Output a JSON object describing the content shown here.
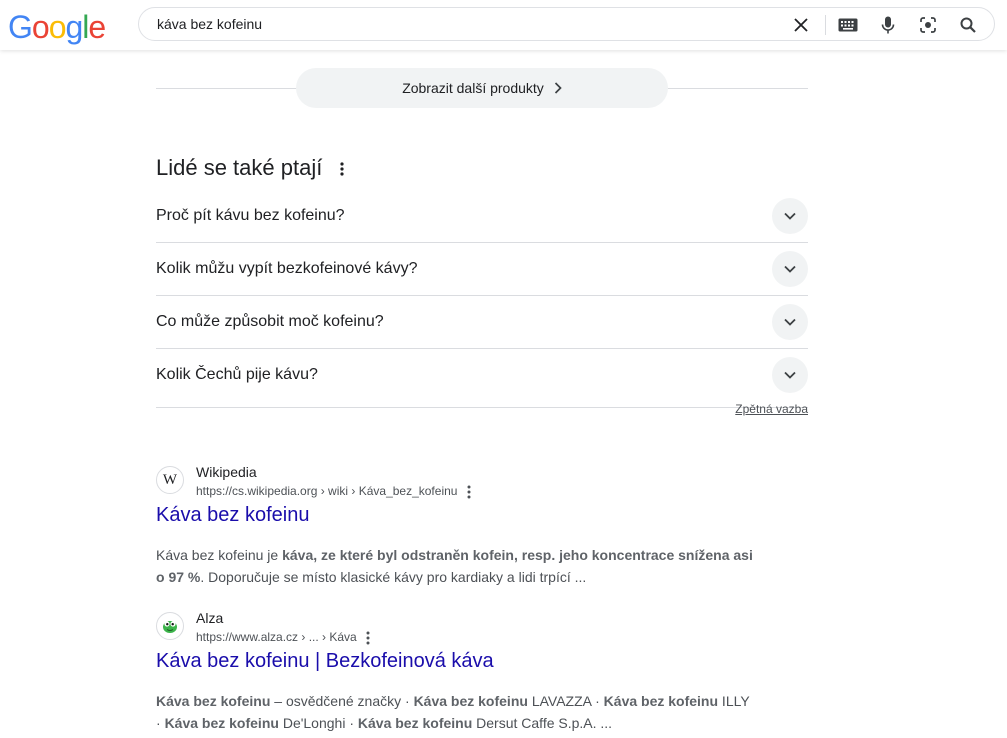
{
  "search": {
    "logo": "Google",
    "query": "káva bez kofeinu",
    "logo_colors": [
      "#4285F4",
      "#EA4335",
      "#FBBC05",
      "#4285F4",
      "#34A853",
      "#EA4335"
    ]
  },
  "more_products": {
    "label": "Zobrazit další produkty"
  },
  "paa": {
    "title": "Lidé se také ptají",
    "questions": [
      "Proč pít kávu bez kofeinu?",
      "Kolik můžu vypít bezkofeinové kávy?",
      "Co může způsobit moč kofeinu?",
      "Kolik Čechů pije kávu?"
    ],
    "feedback": "Zpětná vazba"
  },
  "results": [
    {
      "site": "Wikipedia",
      "url": "https://cs.wikipedia.org › wiki › Káva_bez_kofeinu",
      "title": "Káva bez kofeinu",
      "snippet_parts": [
        {
          "t": "Káva bez kofeinu je ",
          "b": false
        },
        {
          "t": "káva, ze které byl odstraněn kofein, resp. jeho koncentrace snížena asi o 97 %",
          "b": true
        },
        {
          "t": ". Doporučuje se místo klasické kávy pro kardiaky a lidi trpící ...",
          "b": false
        }
      ]
    },
    {
      "site": "Alza",
      "url": "https://www.alza.cz › ... › Káva",
      "title": "Káva bez kofeinu | Bezkofeinová káva",
      "snippet_parts": [
        {
          "t": "Káva bez kofeinu",
          "b": true
        },
        {
          "t": " – osvědčené značky · ",
          "b": false
        },
        {
          "t": "Káva bez kofeinu",
          "b": true
        },
        {
          "t": " LAVAZZA · ",
          "b": false
        },
        {
          "t": "Káva bez kofeinu",
          "b": true
        },
        {
          "t": " ILLY · ",
          "b": false
        },
        {
          "t": "Káva bez kofeinu",
          "b": true
        },
        {
          "t": " De'Longhi · ",
          "b": false
        },
        {
          "t": "Káva bez kofeinu",
          "b": true
        },
        {
          "t": " Dersut Caffe S.p.A. ...",
          "b": false
        }
      ]
    }
  ]
}
